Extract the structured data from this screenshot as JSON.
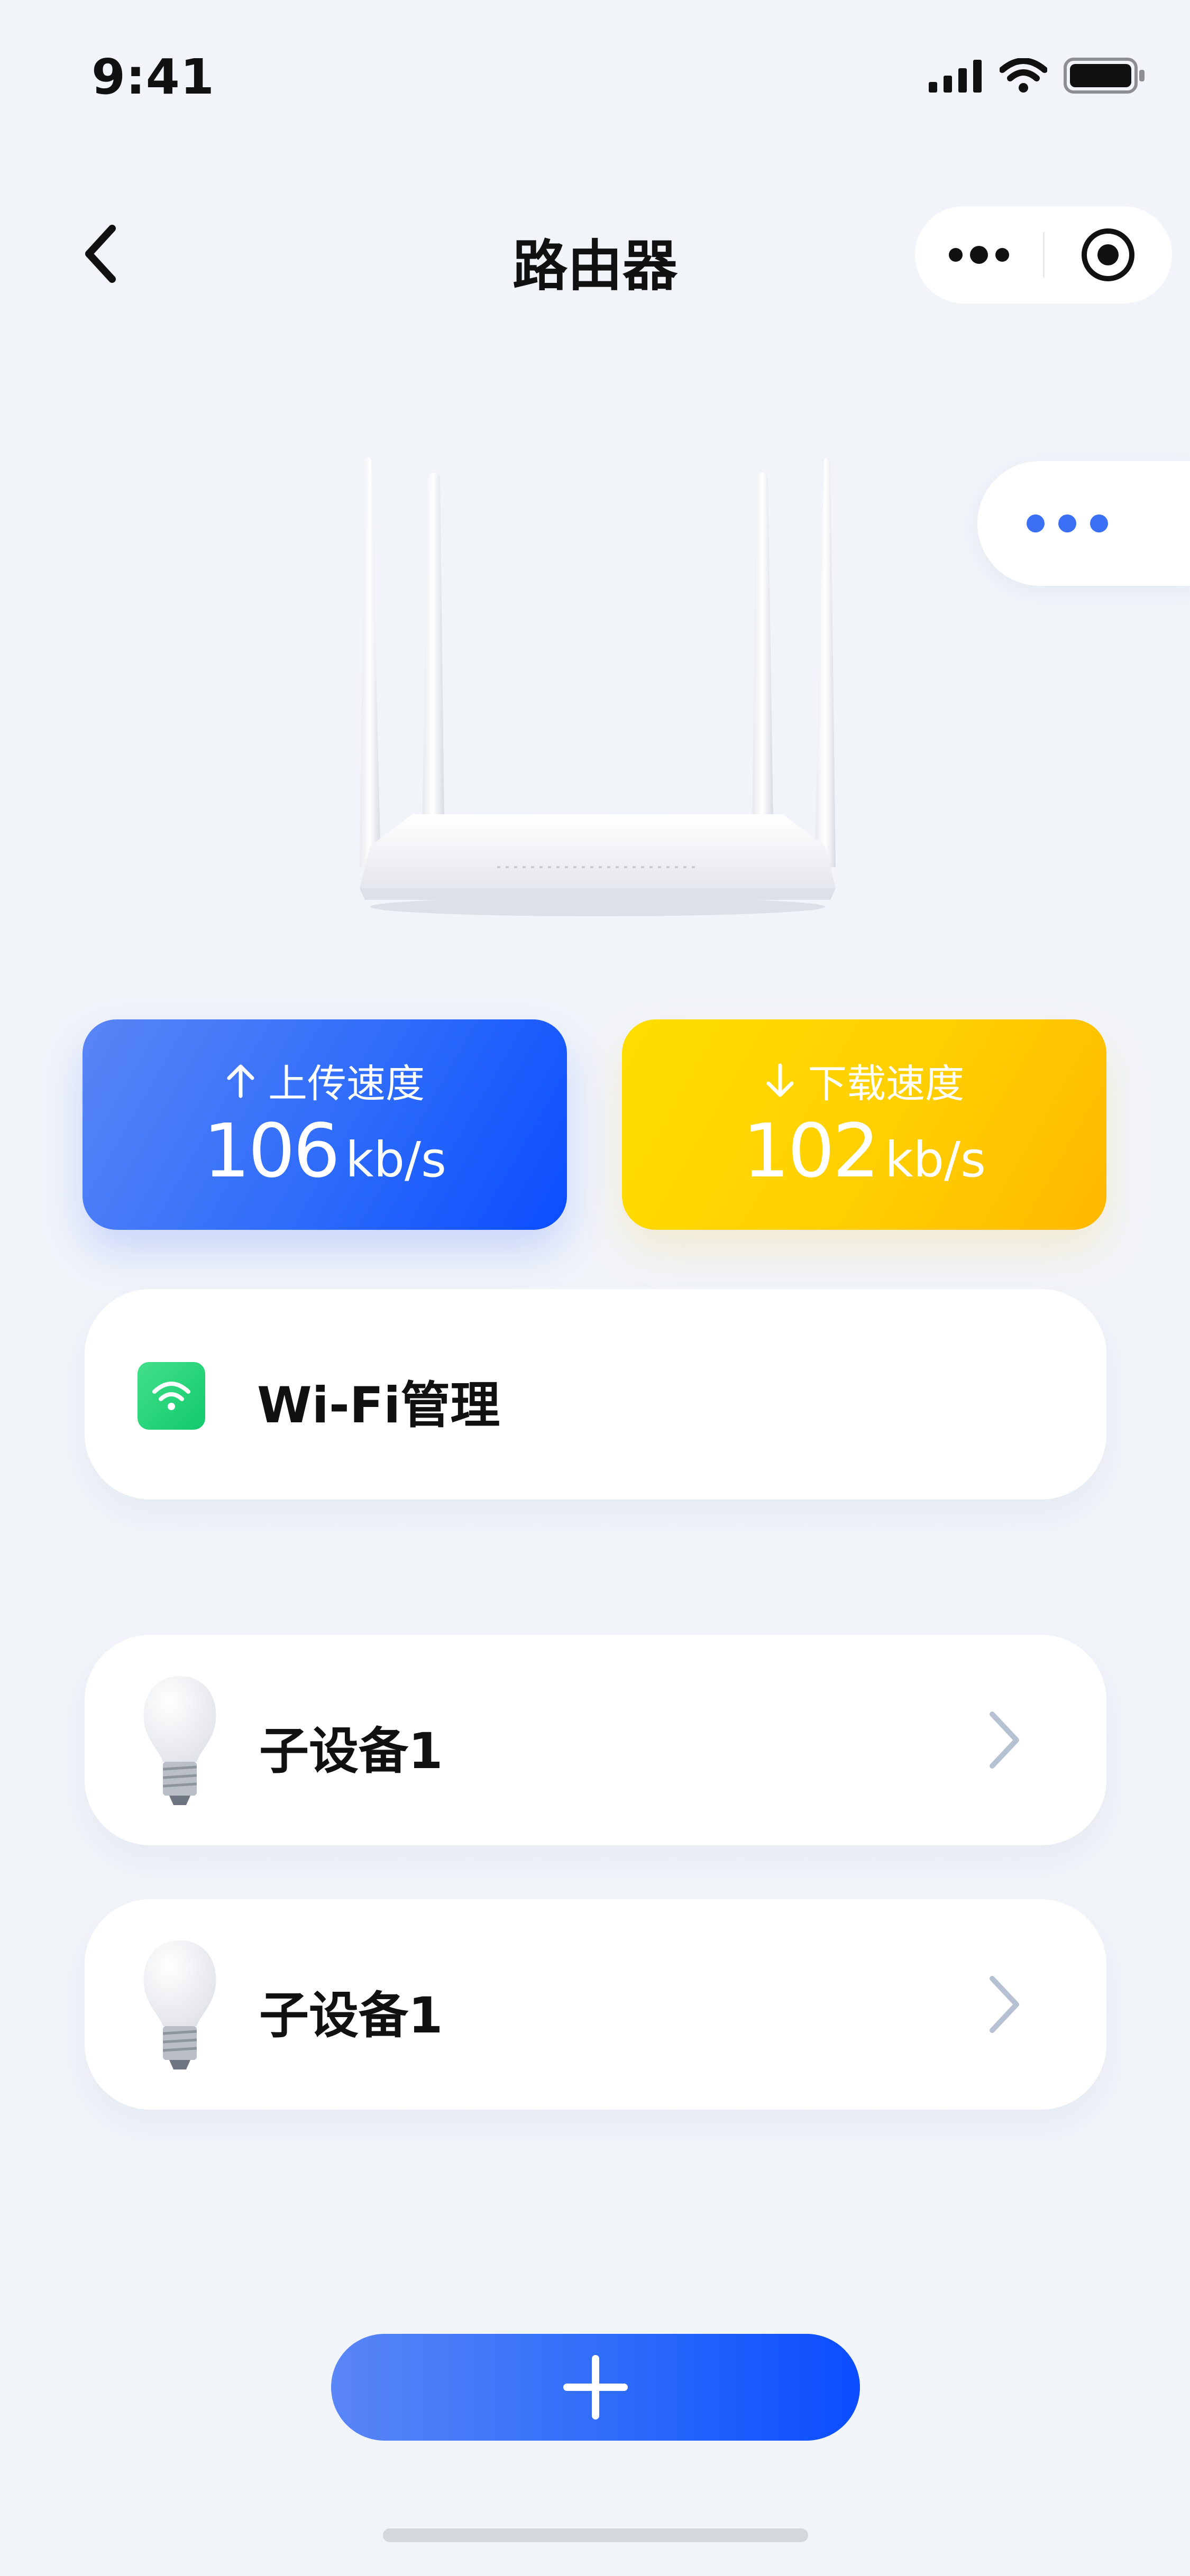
{
  "status_bar": {
    "time": "9:41"
  },
  "nav": {
    "title": "路由器"
  },
  "speed": {
    "upload": {
      "label": "上传速度",
      "value": "106",
      "unit": "kb/s"
    },
    "download": {
      "label": "下载速度",
      "value": "102",
      "unit": "kb/s"
    }
  },
  "wifi": {
    "label": "Wi-Fi管理"
  },
  "devices": [
    {
      "label": "子设备1"
    },
    {
      "label": "子设备1"
    }
  ],
  "colors": {
    "accent_blue": "#2d6bfa",
    "accent_yellow": "#ffcf00",
    "wifi_green": "#12c96d",
    "background": "#f1f4f9"
  },
  "icons": [
    "back-icon",
    "more-icon",
    "target-icon",
    "wifi-icon",
    "bulb-icon",
    "chevron-right-icon",
    "plus-icon",
    "arrow-up-icon",
    "arrow-down-icon",
    "signal-icon",
    "battery-icon"
  ]
}
